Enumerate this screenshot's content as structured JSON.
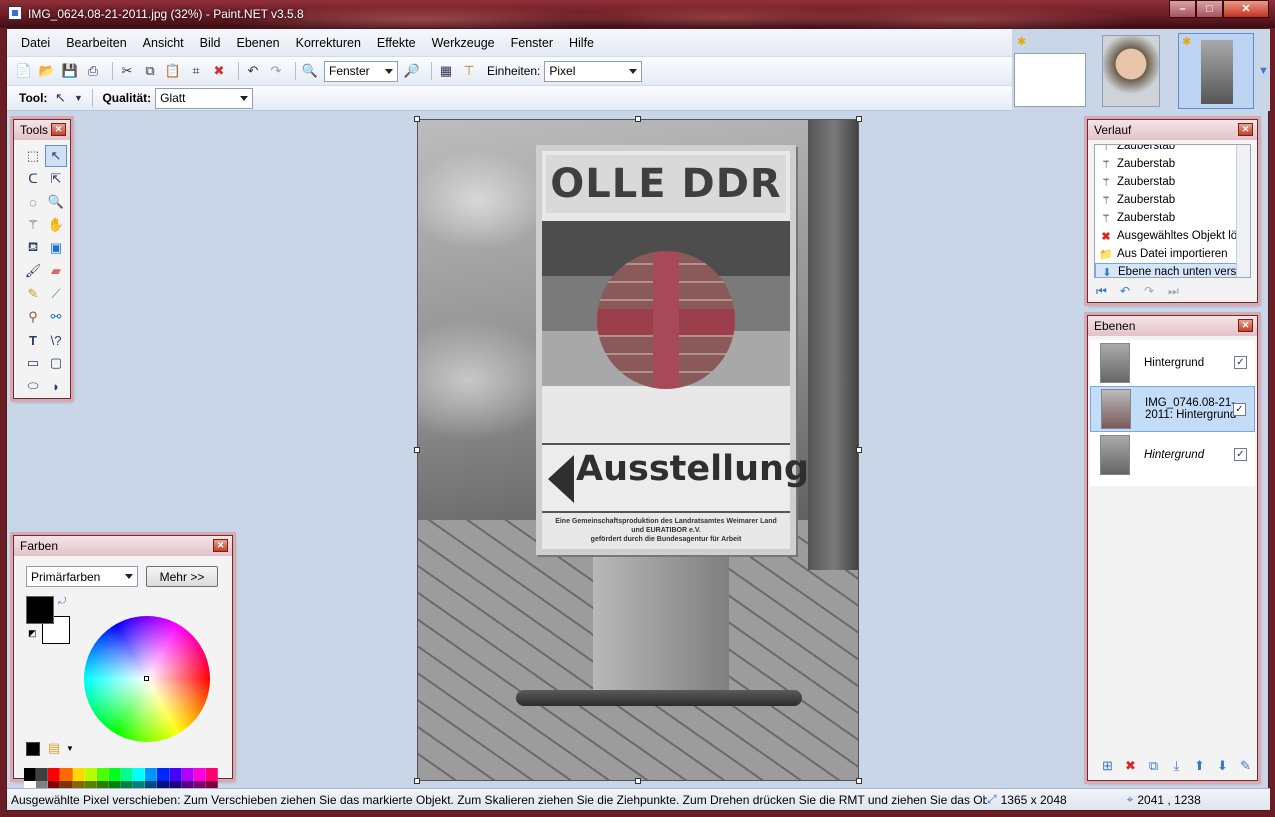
{
  "window": {
    "title": "IMG_0624.08-21-2011.jpg (32%) - Paint.NET v3.5.8",
    "controls": [
      "–",
      "□",
      "✕"
    ]
  },
  "menu": [
    "Datei",
    "Bearbeiten",
    "Ansicht",
    "Bild",
    "Ebenen",
    "Korrekturen",
    "Effekte",
    "Werkzeuge",
    "Fenster",
    "Hilfe"
  ],
  "toolbar": {
    "zoom_value": "Fenster",
    "units_label": "Einheiten:",
    "units_value": "Pixel",
    "tool_label": "Tool:",
    "quality_label": "Qualität:",
    "quality_value": "Glatt"
  },
  "canvas": {
    "sign_title": "OLLE DDR",
    "sign_word": "Ausstellung",
    "sign_small_1": "Eine Gemeinschaftsproduktion des Landratsamtes Weimarer Land",
    "sign_small_2": "und EURATIBOR e.V.",
    "sign_small_3": "gefördert durch die Bundesagentur für Arbeit"
  },
  "tools_panel": {
    "title": "Tools"
  },
  "history_panel": {
    "title": "Verlauf",
    "items": [
      {
        "label": "Zauberstab",
        "icon": "magic-wand-icon"
      },
      {
        "label": "Zauberstab",
        "icon": "magic-wand-icon"
      },
      {
        "label": "Zauberstab",
        "icon": "magic-wand-icon"
      },
      {
        "label": "Zauberstab",
        "icon": "magic-wand-icon"
      },
      {
        "label": "Zauberstab",
        "icon": "magic-wand-icon"
      },
      {
        "label": "Ausgewähltes Objekt lö...",
        "icon": "delete-icon"
      },
      {
        "label": "Aus Datei importieren",
        "icon": "import-icon"
      },
      {
        "label": "Ebene nach unten vers...",
        "icon": "move-down-icon"
      }
    ]
  },
  "layers_panel": {
    "title": "Ebenen",
    "layers": [
      {
        "name": "Hintergrund",
        "checked": true,
        "italic": false
      },
      {
        "name": "IMG_0746.08-21-2011: Hintergrund",
        "checked": true,
        "italic": false
      },
      {
        "name": "Hintergrund",
        "checked": true,
        "italic": true
      }
    ]
  },
  "colors_panel": {
    "title": "Farben",
    "mode": "Primärfarben",
    "more_button": "Mehr >>",
    "primary_color": "#000000",
    "secondary_color": "#ffffff"
  },
  "status": {
    "message": "Ausgewählte Pixel verschieben: Zum Verschieben ziehen Sie das markierte Objekt. Zum Skalieren ziehen Sie die Ziehpunkte. Zum Drehen drücken Sie die RMT und ziehen Sie das Objekt.",
    "image_size": "1365 x 2048",
    "cursor_pos": "2041 , 1238"
  },
  "colors": {
    "accent": "#3b78c8",
    "frame": "#6b1d24",
    "workspace": "#c9d6e8"
  }
}
